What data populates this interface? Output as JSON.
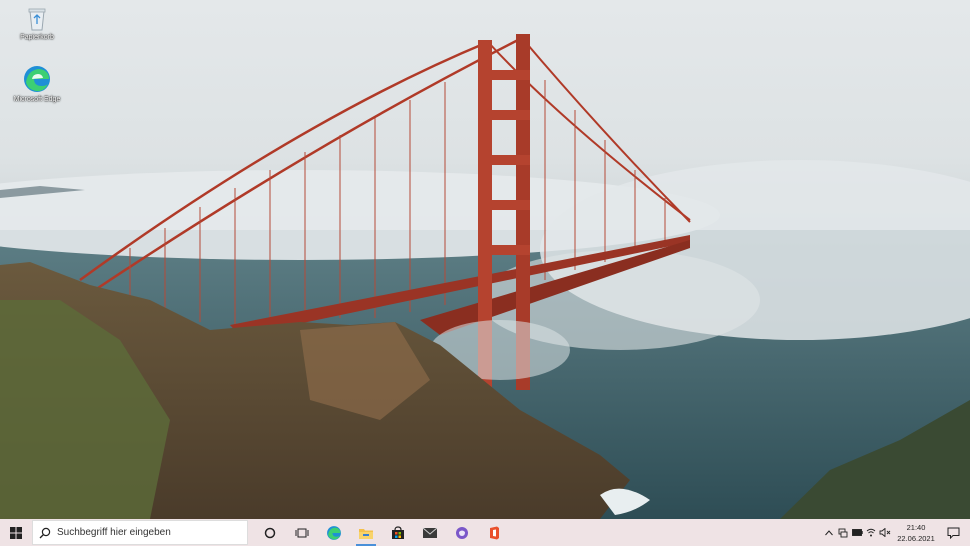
{
  "desktop": {
    "icons": [
      {
        "name": "recycle-bin-icon",
        "label": "Papierkorb"
      },
      {
        "name": "edge-icon",
        "label": "Microsoft Edge"
      }
    ]
  },
  "taskbar": {
    "start_icon": "windows-start-icon",
    "search_placeholder": "Suchbegriff hier eingeben",
    "pinned": [
      "cortana-icon",
      "task-view-icon",
      "edge-icon",
      "file-explorer-icon",
      "store-icon",
      "mail-icon",
      "app-icon",
      "office-icon"
    ],
    "tray_icons": [
      "chevron-up-icon",
      "network-icon",
      "battery-icon",
      "wifi-icon",
      "volume-muted-icon"
    ],
    "time": "21:40",
    "date": "22.06.2021",
    "notifications_icon": "notification-icon",
    "background_color": "#efe3e5"
  }
}
